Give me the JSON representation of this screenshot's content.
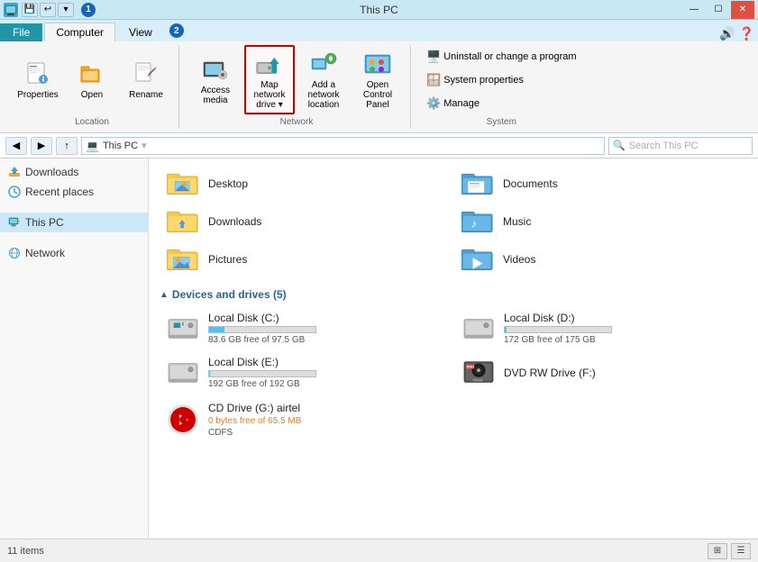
{
  "window": {
    "title": "This PC",
    "controls": {
      "minimize": "—",
      "maximize": "☐",
      "close": "✕"
    }
  },
  "quick_access": [
    "🖫",
    "↩",
    "▼"
  ],
  "ribbon": {
    "tabs": [
      "File",
      "Computer",
      "View"
    ],
    "active_tab": "Computer",
    "groups": {
      "location": {
        "label": "Location",
        "buttons": [
          {
            "id": "properties",
            "icon": "🪟",
            "label": "Properties"
          },
          {
            "id": "open",
            "icon": "📂",
            "label": "Open"
          },
          {
            "id": "rename",
            "icon": "✏️",
            "label": "Rename"
          }
        ]
      },
      "network": {
        "label": "Network",
        "buttons": [
          {
            "id": "access-media",
            "label": "Access\nmedia"
          },
          {
            "id": "map-network-drive",
            "label": "Map network\ndrive ▾",
            "highlighted": true
          },
          {
            "id": "add-network-location",
            "label": "Add a network\nlocation"
          },
          {
            "id": "open-control-panel",
            "label": "Open Control\nPanel"
          }
        ]
      },
      "system": {
        "label": "System",
        "buttons": [
          {
            "id": "uninstall",
            "label": "Uninstall or change a program"
          },
          {
            "id": "sys-properties",
            "label": "System properties"
          },
          {
            "id": "manage",
            "label": "Manage"
          }
        ]
      }
    }
  },
  "address_bar": {
    "path": "This PC",
    "search_placeholder": "Search This PC"
  },
  "sidebar": {
    "sections": [
      {
        "items": [
          {
            "id": "downloads",
            "label": "Downloads",
            "icon": "📥"
          },
          {
            "id": "recent-places",
            "label": "Recent places",
            "icon": "🕐"
          }
        ]
      },
      {
        "items": [
          {
            "id": "this-pc",
            "label": "This PC",
            "icon": "💻",
            "selected": true
          }
        ]
      },
      {
        "items": [
          {
            "id": "network",
            "label": "Network",
            "icon": "🌐"
          }
        ]
      }
    ]
  },
  "content": {
    "folders_title": "Devices and drives (5)",
    "folders": [
      {
        "id": "desktop",
        "name": "Desktop"
      },
      {
        "id": "documents",
        "name": "Documents"
      },
      {
        "id": "downloads",
        "name": "Downloads"
      },
      {
        "id": "music",
        "name": "Music"
      },
      {
        "id": "pictures",
        "name": "Pictures"
      },
      {
        "id": "videos",
        "name": "Videos"
      }
    ],
    "devices_title": "Devices and drives (5)",
    "drives": [
      {
        "id": "local-c",
        "name": "Local Disk (C:)",
        "free": "83.6 GB free of 97.5 GB",
        "fill_pct": 14,
        "low": false,
        "type": "hdd"
      },
      {
        "id": "local-d",
        "name": "Local Disk (D:)",
        "free": "172 GB free of 175 GB",
        "fill_pct": 2,
        "low": false,
        "type": "hdd"
      },
      {
        "id": "local-e",
        "name": "Local Disk (E:)",
        "free": "192 GB free of 192 GB",
        "fill_pct": 1,
        "low": false,
        "type": "hdd"
      },
      {
        "id": "dvd-f",
        "name": "DVD RW Drive (F:)",
        "free": null,
        "fill_pct": 0,
        "low": false,
        "type": "dvd"
      }
    ],
    "cd_drive": {
      "id": "cd-g",
      "name": "CD Drive (G:) airtel",
      "free_label": "0 bytes free of 65.5 MB",
      "fs_label": "CDFS",
      "type": "cd"
    }
  },
  "status_bar": {
    "item_count": "11 items"
  },
  "callouts": {
    "c1": "1",
    "c2": "2"
  }
}
